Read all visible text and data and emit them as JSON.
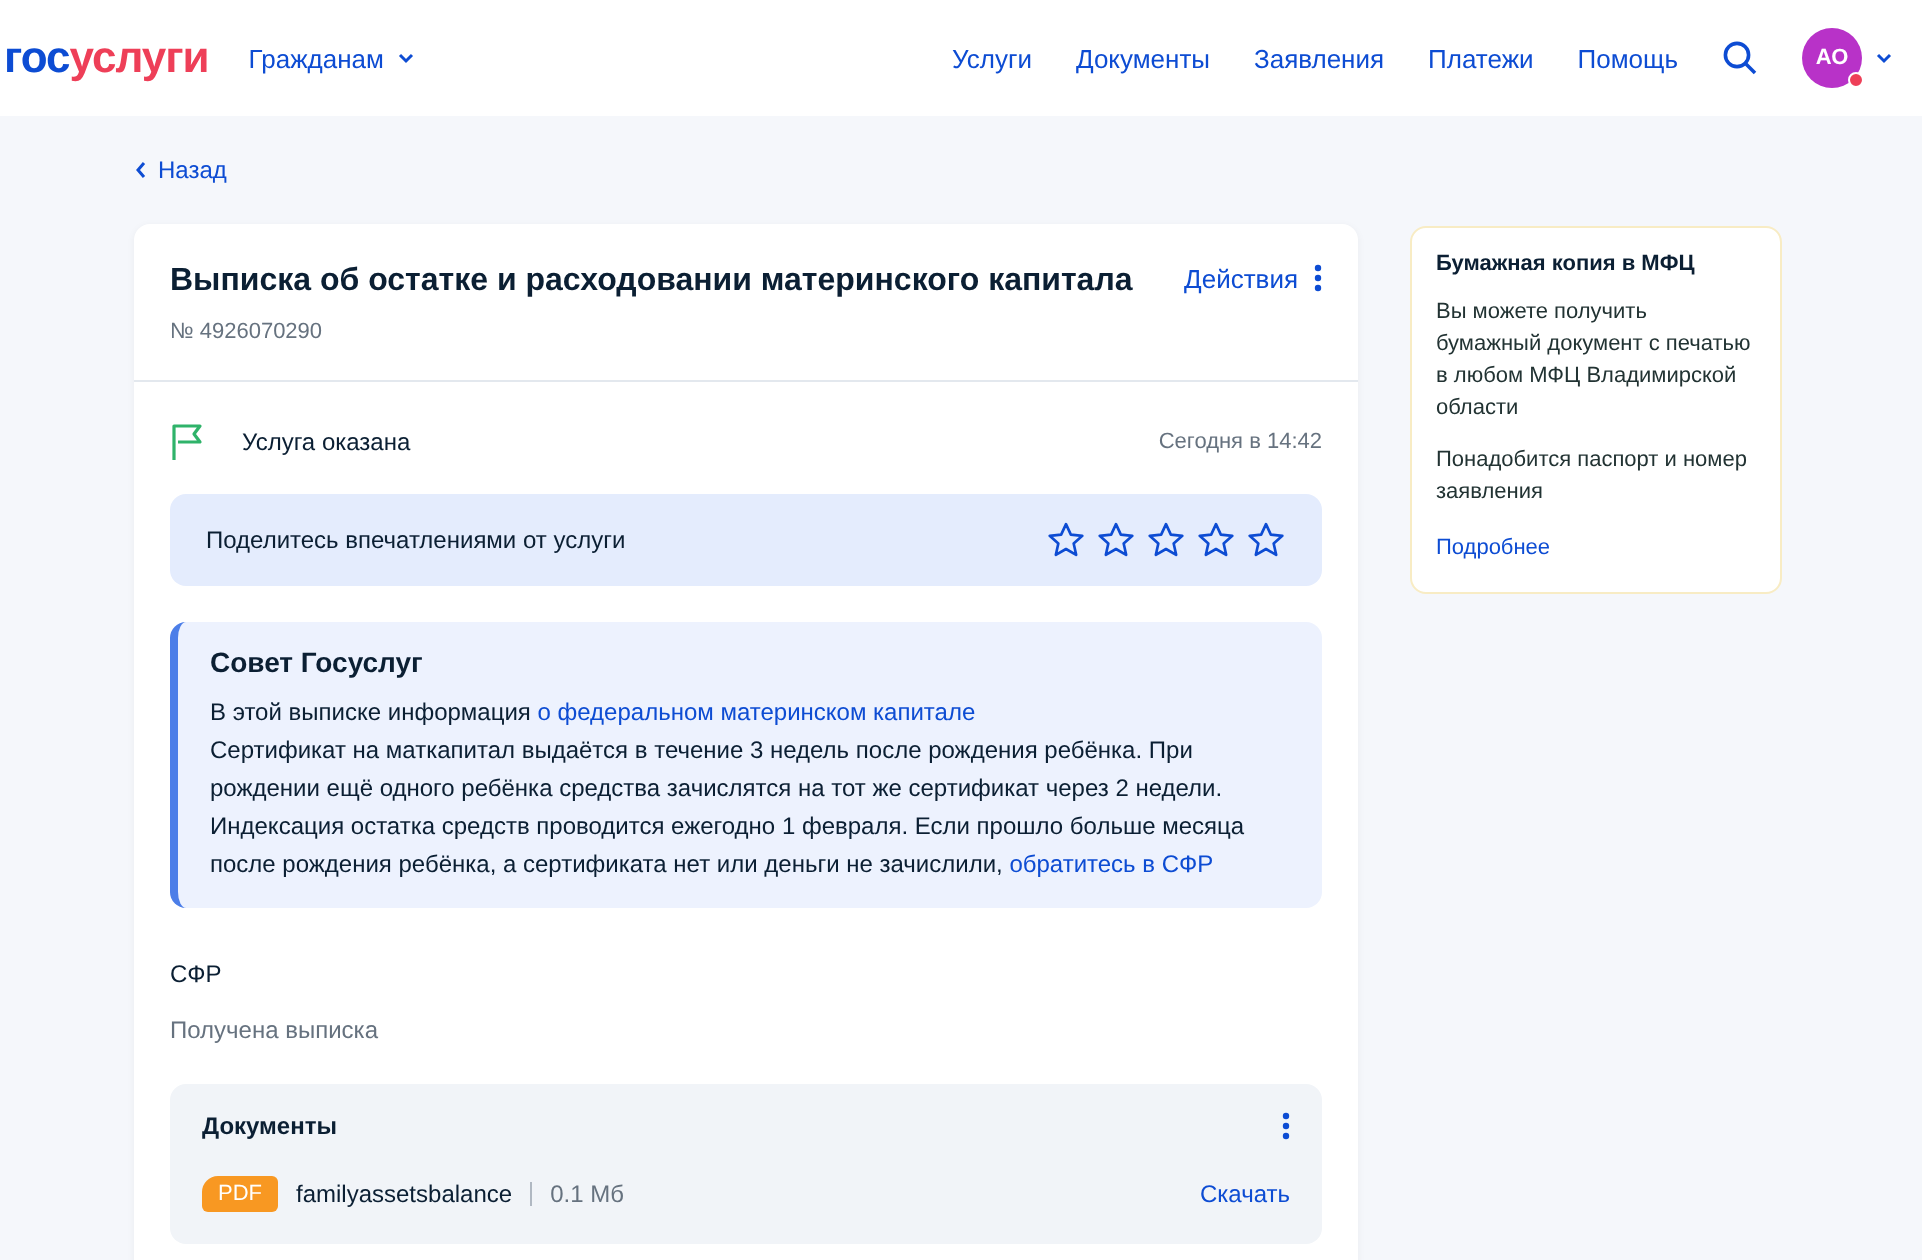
{
  "header": {
    "logo": {
      "first": "гос",
      "second": "услуги"
    },
    "audience": "Гражданам",
    "nav": [
      "Услуги",
      "Документы",
      "Заявления",
      "Платежи",
      "Помощь"
    ],
    "avatar": {
      "initials": "АО",
      "notification": true
    }
  },
  "back": "Назад",
  "order": {
    "title": "Выписка об остатке и расходовании материнского капитала",
    "number": "№ 4926070290",
    "actions": "Действия",
    "status": {
      "label": "Услуга оказана",
      "time": "Сегодня в 14:42"
    },
    "rating": {
      "prompt": "Поделитесь впечатлениями от услуги",
      "stars": 0
    },
    "advice": {
      "title": "Совет Госуслуг",
      "paragraphs": [
        {
          "text": "В этой выписке информация ",
          "link": "о федеральном материнском капитале"
        },
        {
          "text": "Сертификат на маткапитал выдаётся в течение 3 недель после рождения ребёнка. При рождении ещё одного ребёнка средства зачислятся на тот же сертификат через 2 недели. Индексация остатка средств проводится ежегодно 1 февраля. Если прошло больше месяца после рождения ребёнка, а сертификата нет или деньги не зачислили, ",
          "link": "обратитесь в СФР"
        }
      ]
    },
    "agency": "СФР",
    "result": "Получена выписка",
    "documents": {
      "title": "Документы",
      "files": [
        {
          "type": "PDF",
          "name": "familyassetsbalance",
          "size": "0.1 Мб",
          "action": "Скачать"
        }
      ]
    }
  },
  "aside": {
    "title": "Бумажная копия в МФЦ",
    "paragraphs": [
      "Вы можете получить бумажный документ с печатью в любом МФЦ Владимирской области",
      "Понадобится паспорт и номер заявления"
    ],
    "link": "Подробнее"
  }
}
